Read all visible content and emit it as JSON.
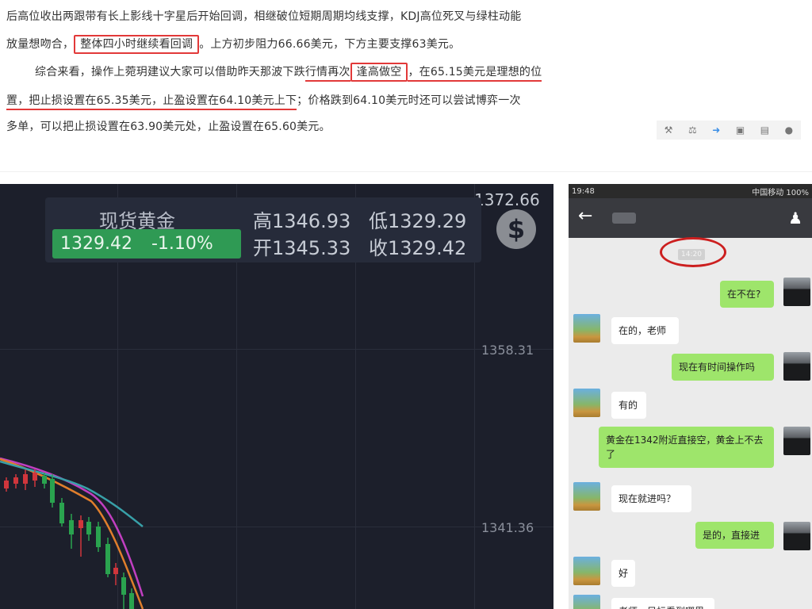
{
  "article": {
    "line1": "后高位收出两跟带有长上影线十字星后开始回调，相继破位短期周期均线支撑，KDJ高位死叉与绿柱动能",
    "line2_pre": "放量想吻合，",
    "line2_box": "整体四小时继续看回调",
    "line2_post": "。上方初步阻力66.66美元，下方主要支撑63美元。",
    "line3_pre": "综合来看，操作上菀玥建议大家可以借助昨天那波下跌",
    "line3_ul1": "行情再次",
    "line3_box": "逢高做空",
    "line3_ul2": "，在65.15美元是理想的位",
    "line4_ul": "置，把止损设置在65.35美元，止盈设置在64.10美元上下",
    "line4_post": "；价格跌到64.10美元时还可以尝试博弈一次",
    "line5": "多单，可以把止损设置在63.90美元处，止盈设置在65.60美元。",
    "toolbar_icons": [
      "wrench-icon",
      "scale-icon",
      "link-icon",
      "bookmark-icon",
      "copy-icon",
      "comment-icon"
    ]
  },
  "chart": {
    "ticker_name": "现货黄金",
    "price": "1329.42",
    "change": "-1.10%",
    "high_label": "高1346.93",
    "low_label": "低1329.29",
    "open_label": "开1345.33",
    "close_label": "收1329.42",
    "top_tick": "1372.66",
    "tick_mid": "1358.31",
    "tick_low": "1341.36",
    "colors": {
      "background": "#1c1f2b",
      "up": "#d0363c",
      "down": "#2aa34f",
      "ma_orange": "#e07e2c",
      "ma_magenta": "#c13fc1",
      "ma_cyan": "#38a0a8"
    }
  },
  "phone": {
    "status_time": "19:48",
    "status_right": "中国移动 100%",
    "time_chip": "14:20",
    "messages": [
      {
        "from": "me",
        "text": "在不在?"
      },
      {
        "from": "them",
        "text": "在的，老师"
      },
      {
        "from": "me",
        "text": "现在有时间操作吗"
      },
      {
        "from": "them",
        "text": "有的"
      },
      {
        "from": "me",
        "text": "黄金在1342附近直接空，黄金上不去了"
      },
      {
        "from": "them",
        "text": "现在就进吗？"
      },
      {
        "from": "me",
        "text": "是的，直接进"
      },
      {
        "from": "them",
        "text": "好"
      },
      {
        "from": "them",
        "text": "老师，目标看到哪里"
      }
    ]
  }
}
